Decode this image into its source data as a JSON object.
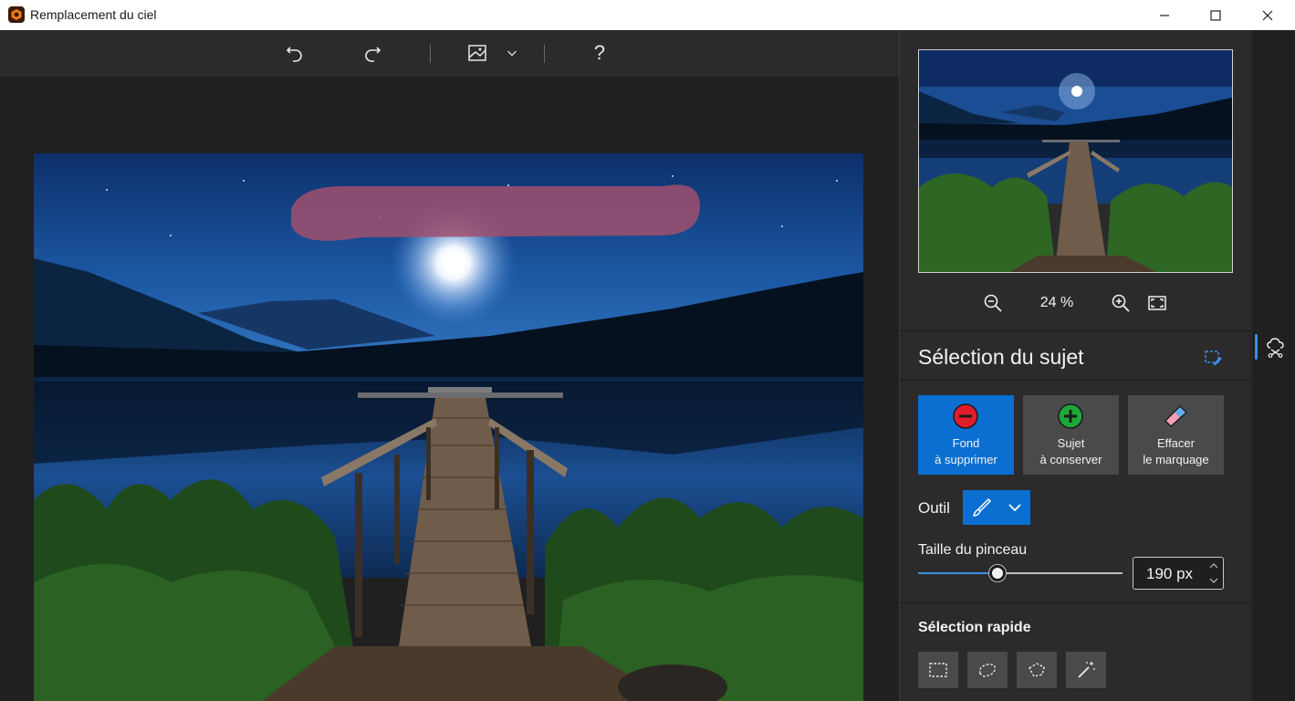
{
  "window": {
    "title": "Remplacement du ciel",
    "app_icon": "app-logo-icon",
    "controls": [
      "minimize-icon",
      "maximize-icon",
      "close-icon"
    ]
  },
  "toolbar": {
    "buttons": [
      "undo-icon",
      "redo-icon",
      "image-view-icon",
      "chevron-down-icon",
      "help-icon"
    ],
    "help_label": "?"
  },
  "navigator": {
    "zoom_value": "24 %",
    "buttons": [
      "zoom-out-icon",
      "zoom-in-icon",
      "fit-screen-icon"
    ]
  },
  "subject_selection": {
    "title": "Sélection du sujet",
    "modes": [
      {
        "line1": "Fond",
        "line2": "à supprimer",
        "icon": "minus-circle-icon",
        "active": true
      },
      {
        "line1": "Sujet",
        "line2": "à conserver",
        "icon": "plus-circle-icon",
        "active": false
      },
      {
        "line1": "Effacer",
        "line2": "le marquage",
        "icon": "eraser-icon",
        "active": false
      }
    ],
    "tool_label": "Outil",
    "tool_icon": "brush-icon",
    "brush_size_label": "Taille du pinceau",
    "brush_size_value": "190 px",
    "brush_size_level": 0.38
  },
  "quick_selection": {
    "title": "Sélection rapide",
    "tools": [
      "rectangle-select-icon",
      "lasso-icon",
      "polygon-lasso-icon",
      "magic-wand-icon"
    ]
  },
  "side_strip": {
    "active_icon": "sky-replace-icon"
  },
  "colors": {
    "accent": "#0a6fd1",
    "panel_bg": "#2b2b2b",
    "app_bg": "#202020",
    "mask_stroke": "#a0506e"
  }
}
